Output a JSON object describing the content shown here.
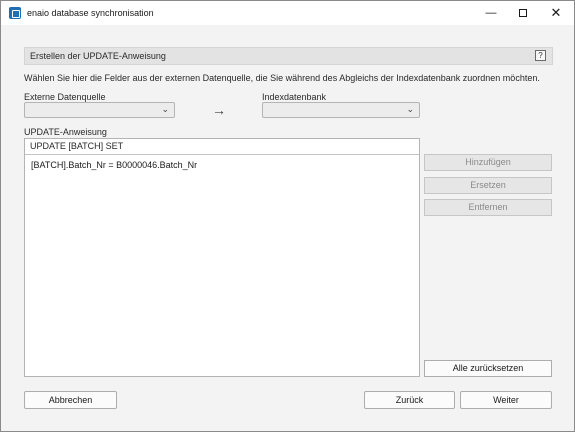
{
  "window": {
    "title": "enaio database synchronisation",
    "minimize_glyph": "—",
    "close_glyph": "✕"
  },
  "section": {
    "title": "Erstellen der UPDATE-Anweisung",
    "help_label": "?"
  },
  "instruction": "Wählen Sie hier die Felder aus der externen Datenquelle, die Sie während des Abgleichs der Indexdatenbank zuordnen möchten.",
  "source": {
    "label": "Externe Datenquelle",
    "selected": ""
  },
  "target": {
    "label": "Indexdatenbank",
    "selected": ""
  },
  "arrow_glyph": "→",
  "chevron_glyph": "⌄",
  "update": {
    "label": "UPDATE-Anweisung",
    "header": "UPDATE [BATCH] SET",
    "lines": [
      "[BATCH].Batch_Nr = B0000046.Batch_Nr"
    ]
  },
  "actions": {
    "add": "Hinzufügen",
    "replace": "Ersetzen",
    "remove": "Entfernen",
    "reset_all": "Alle zurücksetzen"
  },
  "footer": {
    "cancel": "Abbrechen",
    "back": "Zurück",
    "next": "Weiter"
  }
}
